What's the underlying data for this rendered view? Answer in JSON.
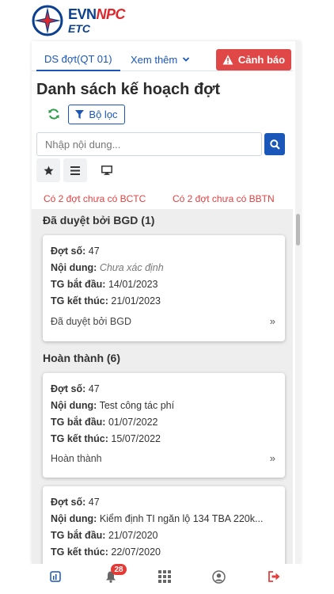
{
  "brand": {
    "line1_main": "EVN",
    "line1_accent": "NPC",
    "line2": "ETC"
  },
  "tabs": {
    "active": "DS đợt(QT 01)",
    "more": "Xem thêm"
  },
  "warning_button": "Cảnh báo",
  "page_title": "Danh sách kế hoạch đợt",
  "filter_button": "Bộ lọc",
  "search": {
    "placeholder": "Nhập nội dung...",
    "value": ""
  },
  "notices": {
    "bctc": "Có 2 đợt chưa có BCTC",
    "bbtn": "Có 2 đợt chưa có BBTN"
  },
  "labels": {
    "so": "Đợt số:",
    "noidung": "Nội dung:",
    "batdau": "TG bắt đầu:",
    "ketthuc": "TG kết thúc:"
  },
  "groups": [
    {
      "title": "Đã duyệt bởi BGD (1)",
      "cards": [
        {
          "so": "47",
          "noidung": "Chưa xác định",
          "batdau": "14/01/2023",
          "ketthuc": "21/01/2023",
          "status": "Đã duyệt bởi BGD"
        }
      ]
    },
    {
      "title": "Hoàn thành (6)",
      "cards": [
        {
          "so": "47",
          "noidung": "Test công tác phí",
          "batdau": "01/07/2022",
          "ketthuc": "15/07/2022",
          "status": "Hoàn thành"
        },
        {
          "so": "47",
          "noidung": "Kiểm định TI ngăn lộ 134 TBA 220k...",
          "batdau": "21/07/2020",
          "ketthuc": "22/07/2020",
          "status": ""
        }
      ]
    }
  ],
  "chevron_glyph": "»",
  "bottom_nav": {
    "notification_count": "28"
  },
  "colors": {
    "primary": "#1a56b8",
    "danger": "#e04848",
    "brand_navy": "#0b3f8f",
    "brand_red": "#e0262b"
  },
  "icons": [
    "evn-logo-icon",
    "chevron-down-icon",
    "warning-icon",
    "refresh-icon",
    "filter-icon",
    "search-icon",
    "star-icon",
    "list-icon",
    "monitor-icon",
    "double-chevron-icon",
    "report-icon",
    "bell-icon",
    "grid-icon",
    "user-icon",
    "logout-icon"
  ]
}
